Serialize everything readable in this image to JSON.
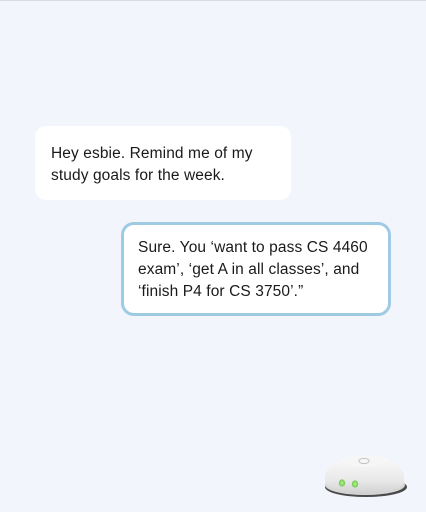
{
  "conversation": {
    "user_message": {
      "lines": [
        "Hey esbie. Remind me of my",
        "study goals for the week."
      ]
    },
    "assistant_message": {
      "lines": [
        "Sure. You ‘want to pass CS 4460",
        "exam’, ‘get A in all classes’, and",
        "‘finish P4 for CS 3750’.”"
      ],
      "border_color": "#9fcbe2"
    }
  },
  "device": {
    "icon": "smart-speaker-icon",
    "indicator_color": "#8ee06a"
  },
  "colors": {
    "background": "#f3f5fd",
    "bubble": "#ffffff"
  }
}
